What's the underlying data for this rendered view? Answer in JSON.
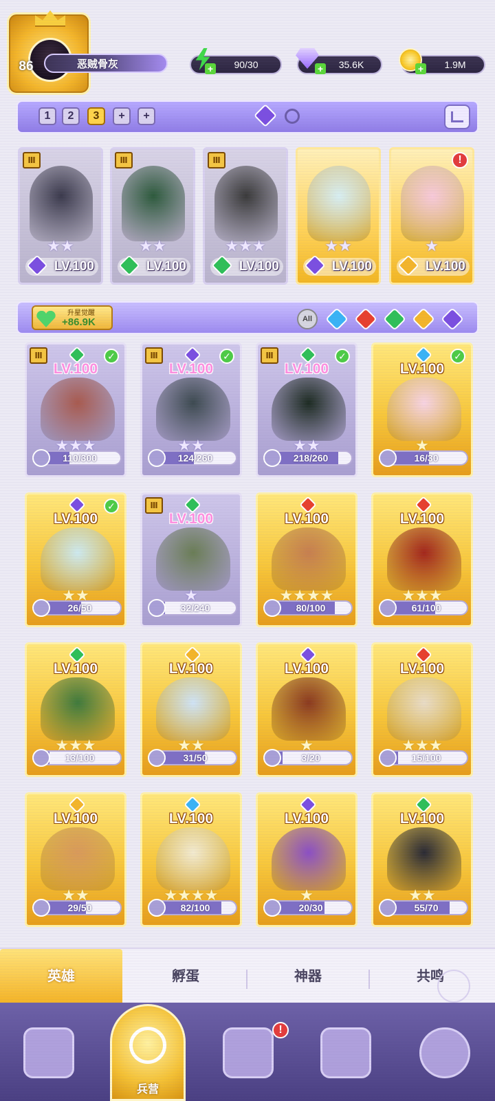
{
  "player": {
    "level": "86",
    "name": "恶贼骨灰"
  },
  "resources": {
    "energy": {
      "value": "90/30",
      "icon": "lightning-icon",
      "color": "#3fd84a"
    },
    "gems": {
      "value": "35.6K",
      "icon": "diamond-icon",
      "color": "#b58cff"
    },
    "gold": {
      "value": "1.9M",
      "icon": "coin-icon",
      "color": "#f8c624"
    }
  },
  "team_bar": {
    "slots": [
      "1",
      "2",
      "3",
      "+",
      "+"
    ],
    "active_slot": "3"
  },
  "team": [
    {
      "level": "LV.100",
      "stars": "★★",
      "rarity": "purple",
      "element": "#7b4fe0",
      "art": "#3b3a4c"
    },
    {
      "level": "LV.100",
      "stars": "★★",
      "rarity": "purple",
      "element": "#2fbf58",
      "art": "#2d5a3c"
    },
    {
      "level": "LV.100",
      "stars": "★★★",
      "rarity": "purple",
      "element": "#2fbf58",
      "art": "#3a3a3a"
    },
    {
      "level": "LV.100",
      "stars": "★★",
      "rarity": "gold",
      "element": "#7b4fe0",
      "art": "#d7eef2"
    },
    {
      "level": "LV.100",
      "stars": "★",
      "rarity": "gold",
      "element": "#f3b52a",
      "art": "#f7c9d9"
    }
  ],
  "wake": {
    "label": "升星觉醒",
    "value": "+86.9K"
  },
  "filters": {
    "all_label": "All",
    "colors": [
      "#3ab3f5",
      "#e7402e",
      "#2fbf58",
      "#f3b52a",
      "#7b4fe0"
    ]
  },
  "heroes": [
    {
      "level": "LV.100",
      "stars": "★★★",
      "shards": "110/300",
      "fill": 0.37,
      "rarity": "purple",
      "element": "#2fbf58",
      "art": "#a85a4e",
      "check": true,
      "rank": true
    },
    {
      "level": "LV.100",
      "stars": "★★",
      "shards": "124/260",
      "fill": 0.48,
      "rarity": "purple",
      "element": "#7b4fe0",
      "art": "#3d4a50",
      "check": true,
      "rank": true
    },
    {
      "level": "LV.100",
      "stars": "★★",
      "shards": "218/260",
      "fill": 0.84,
      "rarity": "purple",
      "element": "#2fbf58",
      "art": "#1d2b22",
      "check": true,
      "rank": true
    },
    {
      "level": "LV.100",
      "stars": "★",
      "shards": "16/30",
      "fill": 0.53,
      "rarity": "gold",
      "element": "#3ab3f5",
      "art": "#f7d3e2",
      "check": true,
      "rank": false
    },
    {
      "level": "LV.100",
      "stars": "★★",
      "shards": "26/50",
      "fill": 0.52,
      "rarity": "gold",
      "element": "#7b4fe0",
      "art": "#cde9ef",
      "check": true,
      "rank": false
    },
    {
      "level": "LV.100",
      "stars": "★",
      "shards": "32/240",
      "fill": 0.13,
      "rarity": "purple",
      "element": "#2fbf58",
      "art": "#6a7d55",
      "check": false,
      "rank": true
    },
    {
      "level": "LV.100",
      "stars": "★★★★",
      "shards": "80/100",
      "fill": 0.8,
      "rarity": "gold",
      "element": "#e7402e",
      "art": "#c77f4f",
      "check": false,
      "rank": false
    },
    {
      "level": "LV.100",
      "stars": "★★★",
      "shards": "61/100",
      "fill": 0.61,
      "rarity": "gold",
      "element": "#e7402e",
      "art": "#a3271c",
      "check": false,
      "rank": false
    },
    {
      "level": "LV.100",
      "stars": "★★★",
      "shards": "13/100",
      "fill": 0.13,
      "rarity": "gold",
      "element": "#2fbf58",
      "art": "#3f7a3c",
      "check": false,
      "rank": false
    },
    {
      "level": "LV.100",
      "stars": "★★",
      "shards": "31/50",
      "fill": 0.62,
      "rarity": "gold",
      "element": "#f3b52a",
      "art": "#cfe3f5",
      "check": false,
      "rank": false
    },
    {
      "level": "LV.100",
      "stars": "★",
      "shards": "3/20",
      "fill": 0.15,
      "rarity": "gold",
      "element": "#7b4fe0",
      "art": "#8b3a1f",
      "check": false,
      "rank": false
    },
    {
      "level": "LV.100",
      "stars": "★★★",
      "shards": "15/100",
      "fill": 0.15,
      "rarity": "gold",
      "element": "#e7402e",
      "art": "#e9dcc6",
      "check": false,
      "rank": false
    },
    {
      "level": "LV.100",
      "stars": "★★",
      "shards": "29/50",
      "fill": 0.58,
      "rarity": "gold",
      "element": "#f3b52a",
      "art": "#d99a5a",
      "check": false,
      "rank": false
    },
    {
      "level": "LV.100",
      "stars": "★★★★",
      "shards": "82/100",
      "fill": 0.82,
      "rarity": "gold",
      "element": "#3ab3f5",
      "art": "#f2ead0",
      "check": false,
      "rank": false
    },
    {
      "level": "LV.100",
      "stars": "★",
      "shards": "20/30",
      "fill": 0.67,
      "rarity": "gold",
      "element": "#7b4fe0",
      "art": "#8b4fc4",
      "check": false,
      "rank": false
    },
    {
      "level": "LV.100",
      "stars": "★★",
      "shards": "55/70",
      "fill": 0.79,
      "rarity": "gold",
      "element": "#2fbf58",
      "art": "#2a2a34",
      "check": false,
      "rank": false
    }
  ],
  "tabs": {
    "heroes": "英雄",
    "eggs": "孵蛋",
    "artifacts": "神器",
    "resonance": "共鸣"
  },
  "nav": {
    "barracks": "兵营",
    "badge": "!"
  }
}
